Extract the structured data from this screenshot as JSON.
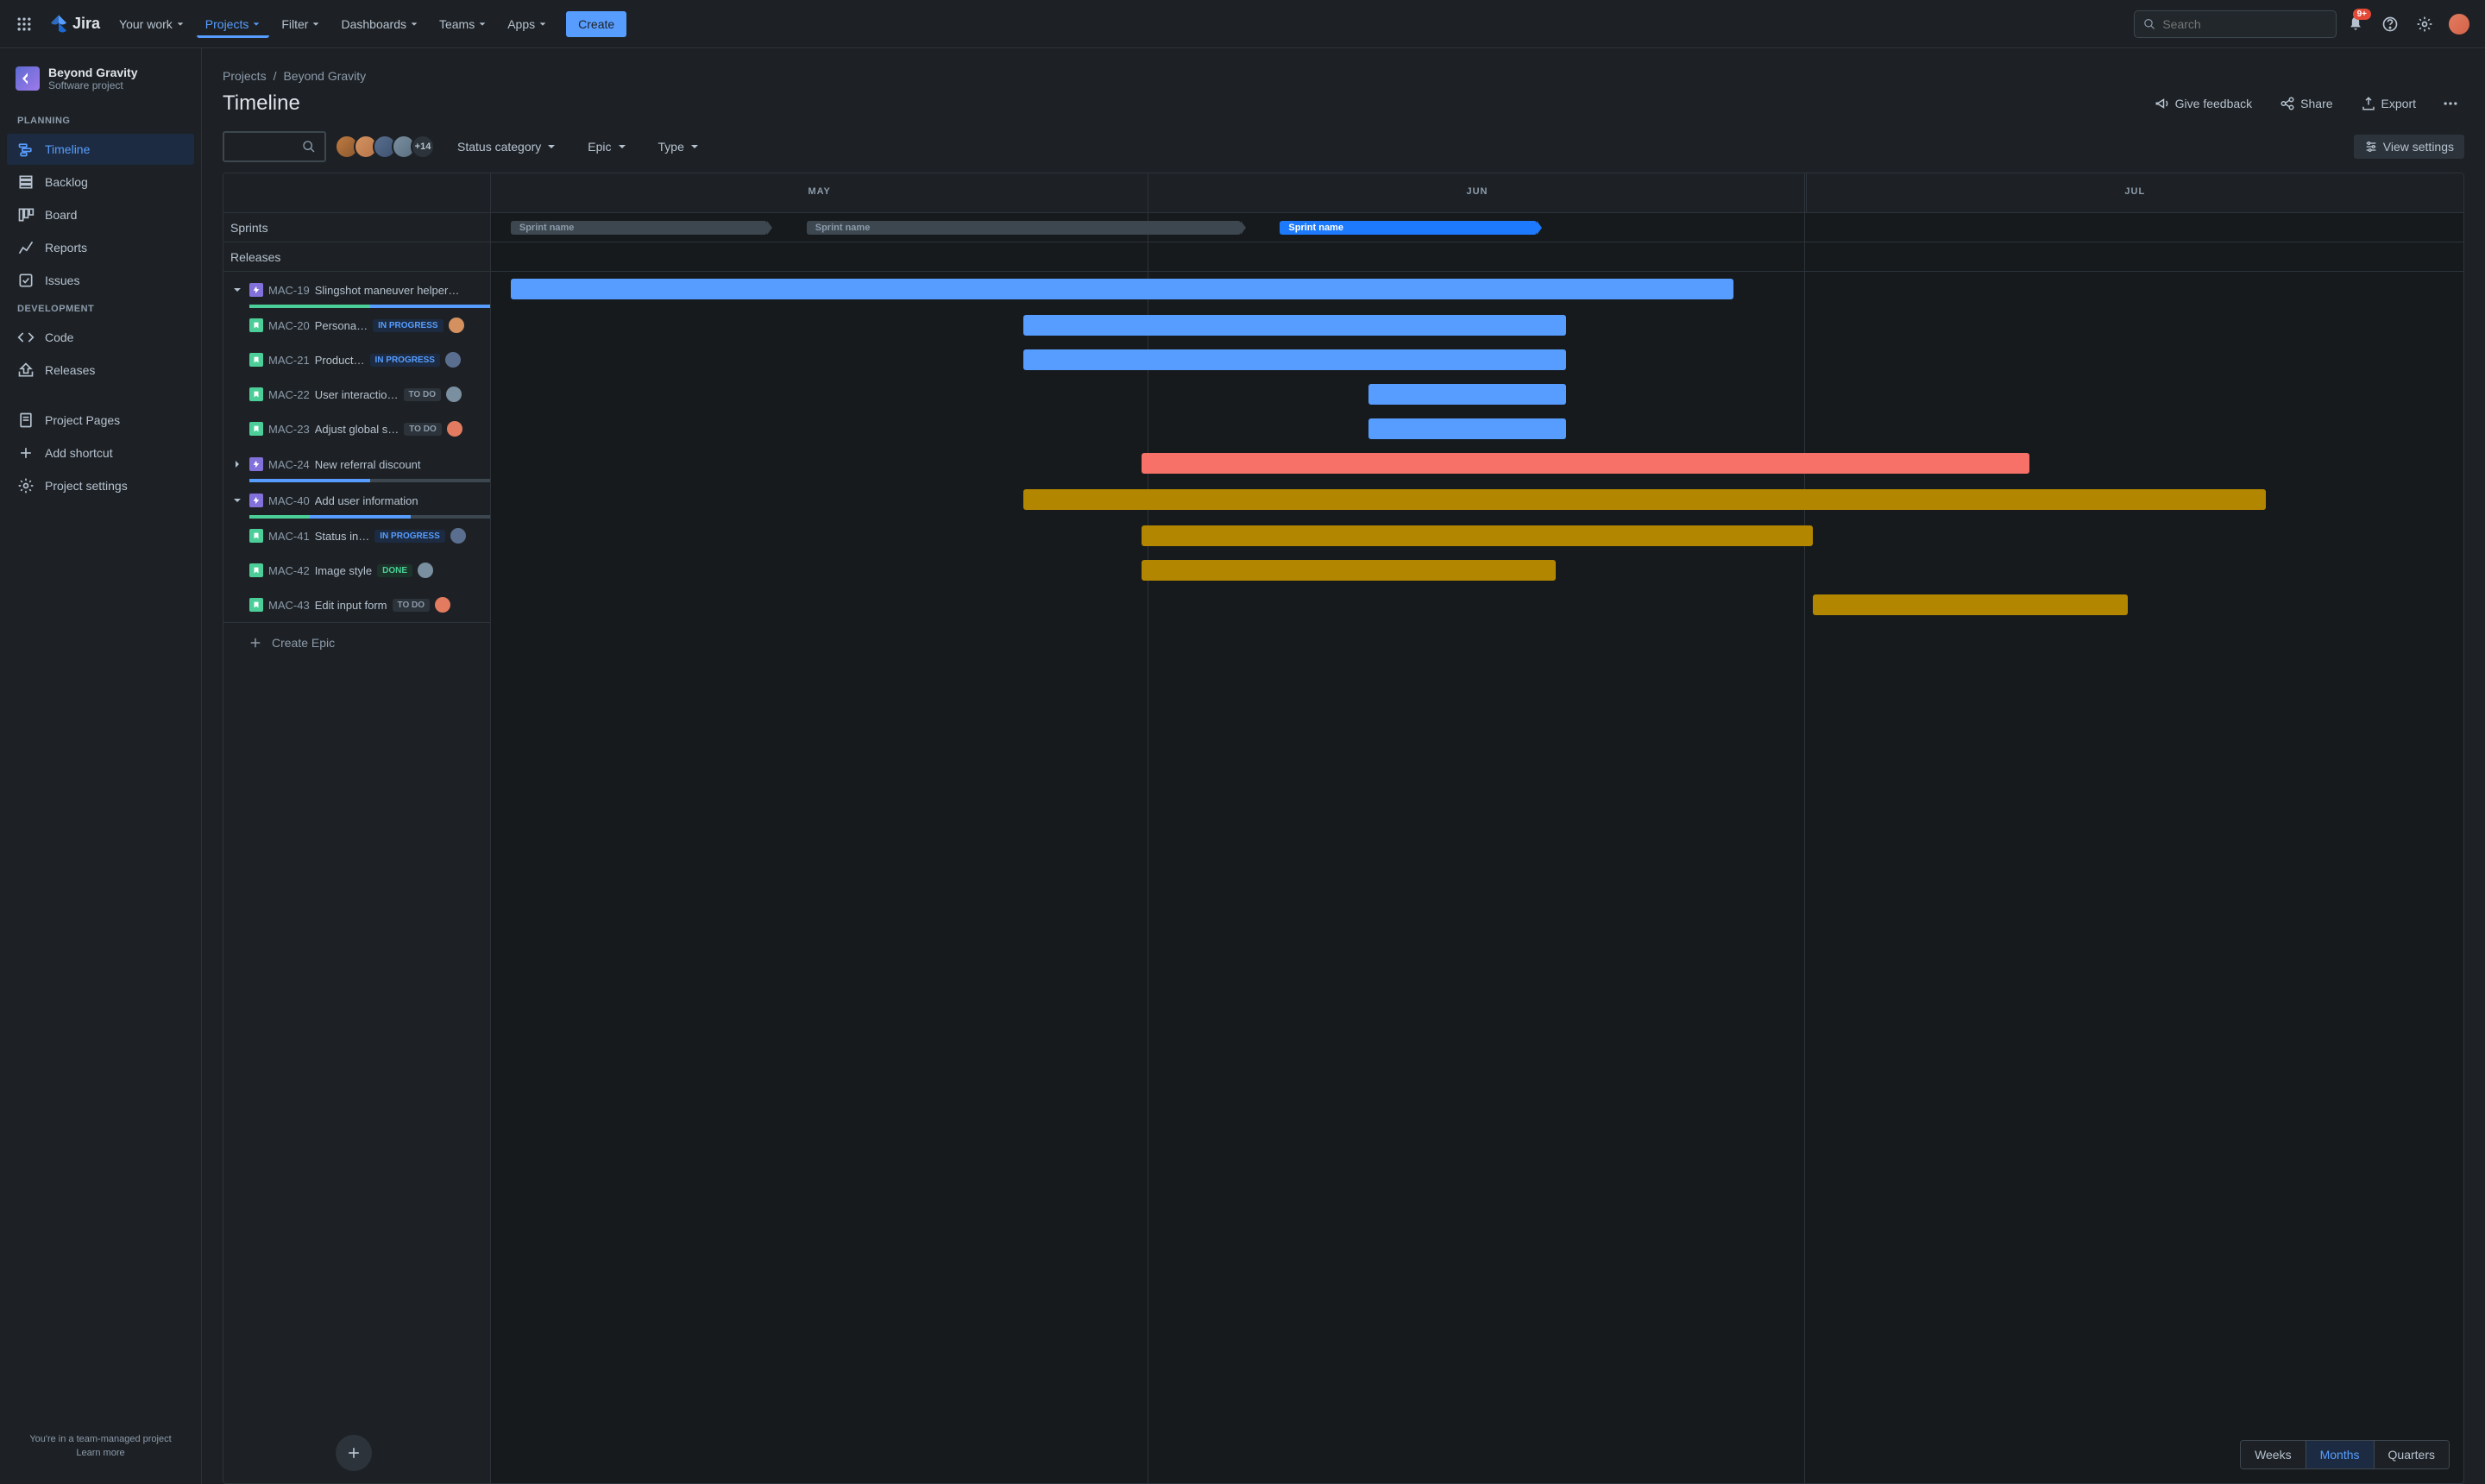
{
  "nav": {
    "yourWork": "Your work",
    "projects": "Projects",
    "filter": "Filter",
    "dashboards": "Dashboards",
    "teams": "Teams",
    "apps": "Apps",
    "create": "Create",
    "searchPlaceholder": "Search",
    "notifBadge": "9+",
    "logoText": "Jira"
  },
  "sidebar": {
    "projectName": "Beyond Gravity",
    "projectType": "Software project",
    "planning": "PLANNING",
    "development": "DEVELOPMENT",
    "items": {
      "timeline": "Timeline",
      "backlog": "Backlog",
      "board": "Board",
      "reports": "Reports",
      "issues": "Issues",
      "code": "Code",
      "releases": "Releases",
      "projectPages": "Project Pages",
      "addShortcut": "Add shortcut",
      "projectSettings": "Project settings"
    },
    "footerText": "You're in a team-managed project",
    "learnMore": "Learn more"
  },
  "breadcrumb": {
    "projects": "Projects",
    "project": "Beyond Gravity",
    "sep": "/"
  },
  "page": {
    "title": "Timeline",
    "giveFeedback": "Give feedback",
    "share": "Share",
    "export": "Export",
    "statusCategory": "Status category",
    "epicFilter": "Epic",
    "typeFilter": "Type",
    "viewSettings": "View settings",
    "avatarOverflow": "+14"
  },
  "timeline": {
    "months": [
      "MAY",
      "JUN",
      "JUL"
    ],
    "sprintsLabel": "Sprints",
    "releasesLabel": "Releases",
    "sprintName": "Sprint name",
    "createEpic": "Create Epic",
    "zoom": {
      "weeks": "Weeks",
      "months": "Months",
      "quarters": "Quarters"
    }
  },
  "issues": [
    {
      "type": "epic",
      "key": "MAC-19",
      "title": "Slingshot maneuver helper…",
      "expanded": true,
      "progress": [
        50,
        50,
        0
      ]
    },
    {
      "type": "story",
      "key": "MAC-20",
      "title": "Persona…",
      "status": "IN PROGRESS"
    },
    {
      "type": "story",
      "key": "MAC-21",
      "title": "Product…",
      "status": "IN PROGRESS"
    },
    {
      "type": "story",
      "key": "MAC-22",
      "title": "User interactio…",
      "status": "TO DO"
    },
    {
      "type": "story",
      "key": "MAC-23",
      "title": "Adjust global s…",
      "status": "TO DO"
    },
    {
      "type": "epic",
      "key": "MAC-24",
      "title": "New referral discount",
      "expanded": false,
      "progress": [
        0,
        50,
        50
      ]
    },
    {
      "type": "epic",
      "key": "MAC-40",
      "title": "Add user information",
      "expanded": true,
      "progress": [
        25,
        42,
        33
      ]
    },
    {
      "type": "story",
      "key": "MAC-41",
      "title": "Status in…",
      "status": "IN PROGRESS"
    },
    {
      "type": "story",
      "key": "MAC-42",
      "title": "Image style",
      "status": "DONE"
    },
    {
      "type": "story",
      "key": "MAC-43",
      "title": "Edit input form",
      "status": "TO DO"
    }
  ]
}
